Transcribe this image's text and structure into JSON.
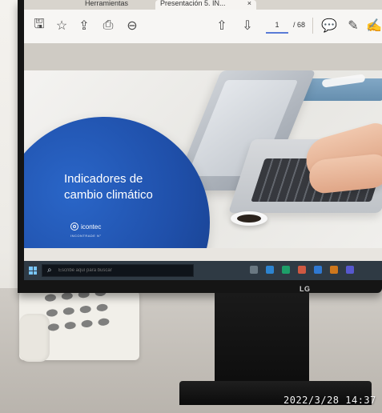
{
  "browser": {
    "tabs": [
      {
        "label": "Herramientas"
      },
      {
        "label": "Presentación 5. IN..."
      }
    ],
    "active_tab_close": "×"
  },
  "pdf_toolbar": {
    "icons": [
      {
        "name": "save-icon",
        "glyph": "🖫"
      },
      {
        "name": "bookmark-star-icon",
        "glyph": "☆"
      },
      {
        "name": "upload-cloud-icon",
        "glyph": "⇪"
      },
      {
        "name": "print-icon",
        "glyph": "⎙"
      },
      {
        "name": "zoom-out-icon",
        "glyph": "⊖"
      },
      {
        "name": "page-up-icon",
        "glyph": "⇧"
      },
      {
        "name": "page-down-icon",
        "glyph": "⇩"
      },
      {
        "name": "comment-icon",
        "glyph": "💬"
      },
      {
        "name": "pen-icon",
        "glyph": "✎"
      },
      {
        "name": "signature-icon",
        "glyph": "✍"
      }
    ],
    "page_current": "1",
    "page_total": "/ 68"
  },
  "slide": {
    "title": "Indicadores de\ncambio climático",
    "brand": "icontec",
    "brand_sub": "INCONTRADE N°"
  },
  "taskbar": {
    "search_placeholder": "Escribe aquí para buscar",
    "apps": [
      {
        "name": "task-view-icon",
        "color": "#6e7b86"
      },
      {
        "name": "file-explorer-icon",
        "color": "#2d88d8"
      },
      {
        "name": "edge-icon",
        "color": "#1ca36c"
      },
      {
        "name": "chrome-icon",
        "color": "#d85b42"
      },
      {
        "name": "mail-icon",
        "color": "#2f7bd9"
      },
      {
        "name": "office-icon",
        "color": "#d77a1a"
      },
      {
        "name": "teams-icon",
        "color": "#5a5ad6"
      }
    ]
  },
  "monitor": {
    "brand": "LG"
  },
  "timestamp": "2022/3/28 14:37",
  "colors": {
    "slide_circle": "#1f4fa9",
    "taskbar": "#2f3a44"
  }
}
